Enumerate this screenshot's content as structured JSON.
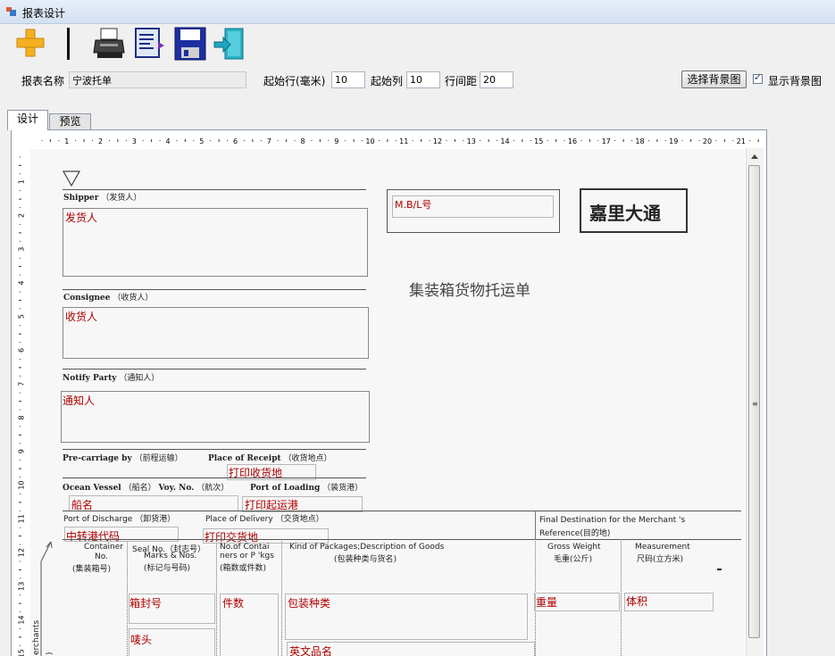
{
  "window": {
    "title": "报表设计"
  },
  "toolbar": {
    "buttons": [
      {
        "name": "add",
        "icon": "plus-icon"
      },
      {
        "name": "separator",
        "icon": "separator-bar"
      },
      {
        "name": "print",
        "icon": "printer-icon"
      },
      {
        "name": "preview",
        "icon": "print-preview-icon"
      },
      {
        "name": "save",
        "icon": "floppy-disk-icon"
      },
      {
        "name": "exit",
        "icon": "exit-door-icon"
      }
    ]
  },
  "settings": {
    "report_name_label": "报表名称",
    "report_name_value": "宁波托单",
    "start_row_label": "起始行(毫米)",
    "start_row_value": "10",
    "start_col_label": "起始列",
    "start_col_value": "10",
    "line_spacing_label": "行间距",
    "line_spacing_value": "20",
    "choose_bg_label": "选择背景图",
    "show_bg_label": "显示背景图",
    "show_bg_checked": true
  },
  "tabs": [
    {
      "label": "设计",
      "active": true
    },
    {
      "label": "预览",
      "active": false
    }
  ],
  "ruler": {
    "h_numbers": [
      "1",
      "2",
      "3",
      "4",
      "5",
      "6",
      "7",
      "8",
      "9",
      "10",
      "11",
      "12",
      "13",
      "14",
      "15",
      "16",
      "17",
      "18",
      "19",
      "20",
      "21"
    ],
    "v_numbers": [
      "1",
      "2",
      "3",
      "4",
      "5",
      "6",
      "7",
      "8",
      "9",
      "10",
      "11",
      "12",
      "13",
      "14",
      "15"
    ]
  },
  "form": {
    "company_logo": "嘉里大通",
    "doc_title": "集装箱货物托运单",
    "shipper": "Shipper",
    "shipper_cn": "（发货人）",
    "consignee": "Consignee",
    "consignee_cn": "（收货人）",
    "notify": "Notify Party",
    "notify_cn": "（通知人）",
    "pre_carriage": "Pre-carriage by",
    "pre_carriage_cn": "（前程运输）",
    "place_receipt": "Place of Receipt",
    "place_receipt_cn": "（收货地点）",
    "ocean_vessel": "Ocean Vessel",
    "ocean_vessel_cn": "（船名）",
    "voy_no": "Voy. No.",
    "voy_no_cn": "（航次）",
    "port_loading": "Port of Loading",
    "port_loading_cn": "（装货港）",
    "port_discharge": "Port of Discharge",
    "port_discharge_cn": "（卸货港）",
    "place_delivery": "Place of Delivery",
    "place_delivery_cn": "（交货地点）",
    "final_dest": "Final Destination for the Merchant 's",
    "final_dest2": "Reference(目的地)",
    "container_no": "Container",
    "container_no2": "No.",
    "container_no_cn": "(集装箱号)",
    "seal_no": "Seal No.（封志号）",
    "marks": "Marks & Nos.",
    "marks_cn": "(标记与号码)",
    "no_of_containers": "No.of Contai",
    "no_of_containers2": "ners or P 'kgs",
    "no_of_containers_cn": "(箱数或件数)",
    "kind_of_packages": "Kind of Packages;Description of Goods",
    "kind_of_packages_cn": "(包装种类与货名)",
    "gross_weight": "Gross Weight",
    "gross_weight_cn": "毛重(公斤)",
    "measurement": "Measurement",
    "measurement_cn": "尺码(立方米)",
    "merchants": "erchants",
    "merchants2": ")"
  },
  "fields": {
    "shipper_field": "发货人",
    "consignee_field": "收货人",
    "notify_field": "通知人",
    "mbl_field": "M.B/L号",
    "print_receipt_field": "打印收货地",
    "vessel_field": "船名",
    "print_loading_field": "打印起运港",
    "transit_port_field": "中转港代码",
    "print_delivery_field": "打印交货地",
    "seal_field": "箱封号",
    "pieces_field": "件数",
    "package_kind_field": "包装种类",
    "weight_field": "重量",
    "volume_field": "体积",
    "marks_field": "唛头",
    "english_name_field": "英文品名"
  }
}
